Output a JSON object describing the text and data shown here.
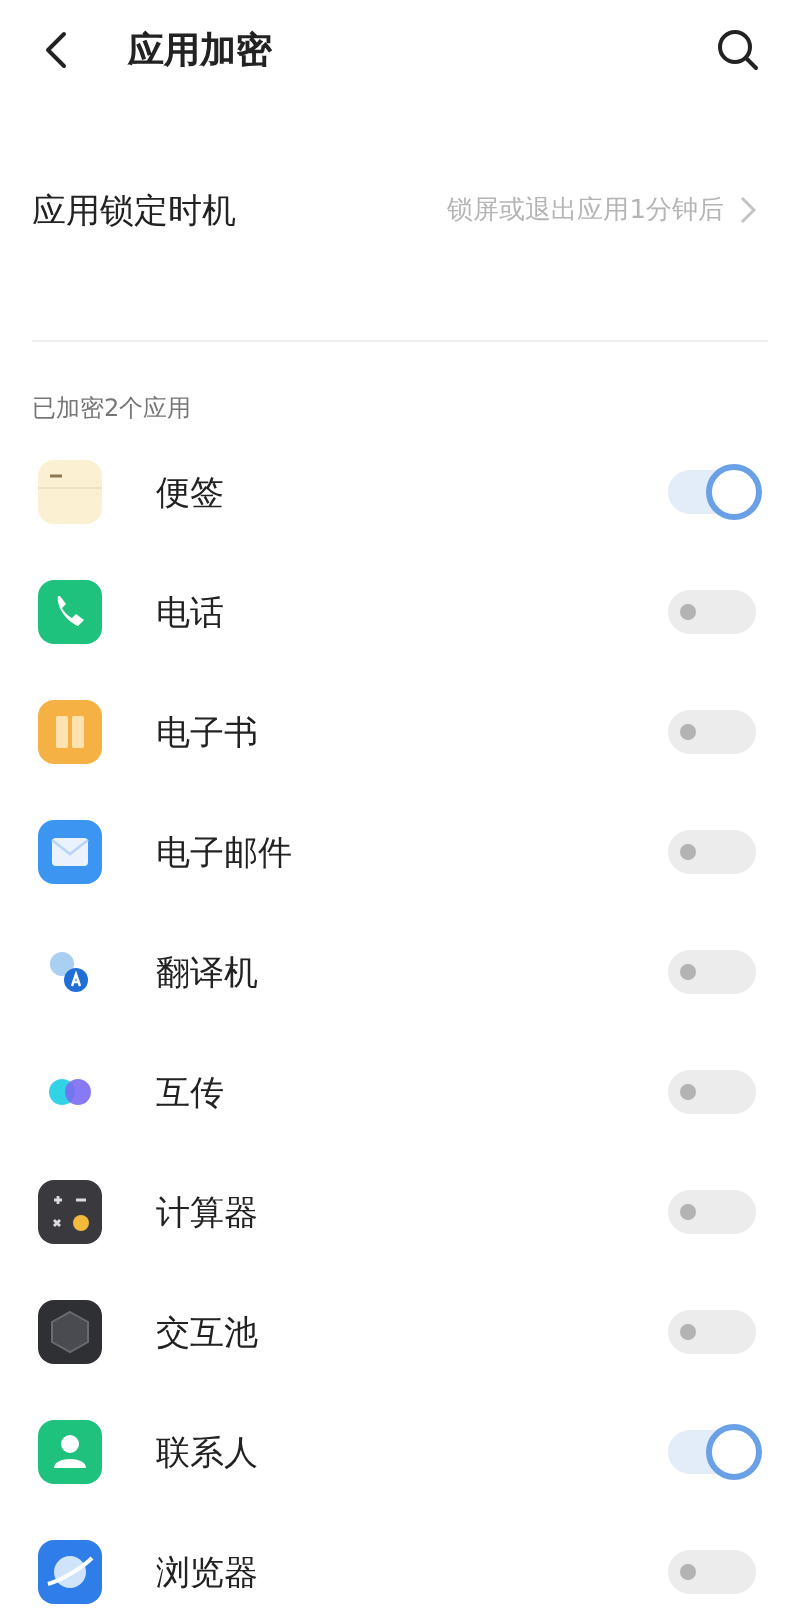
{
  "header": {
    "title": "应用加密"
  },
  "lock_timing": {
    "label": "应用锁定时机",
    "value": "锁屏或退出应用1分钟后"
  },
  "section_label": "已加密2个应用",
  "apps": [
    {
      "name": "便签",
      "kind": "notes",
      "on": true
    },
    {
      "name": "电话",
      "kind": "phone",
      "on": false
    },
    {
      "name": "电子书",
      "kind": "book",
      "on": false
    },
    {
      "name": "电子邮件",
      "kind": "mail",
      "on": false
    },
    {
      "name": "翻译机",
      "kind": "translate",
      "on": false
    },
    {
      "name": "互传",
      "kind": "transfer",
      "on": false
    },
    {
      "name": "计算器",
      "kind": "calculator",
      "on": false
    },
    {
      "name": "交互池",
      "kind": "cube",
      "on": false
    },
    {
      "name": "联系人",
      "kind": "contact",
      "on": true
    },
    {
      "name": "浏览器",
      "kind": "browser",
      "on": false
    }
  ]
}
